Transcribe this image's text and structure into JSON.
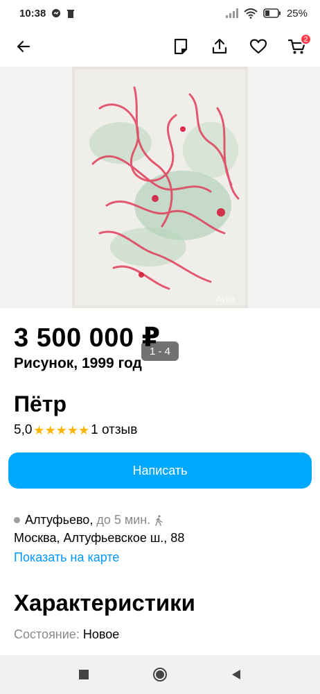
{
  "status_bar": {
    "time": "10:38",
    "battery": "25%"
  },
  "toolbar": {
    "cart_count": "2"
  },
  "gallery": {
    "counter": "1 - 4",
    "watermark": "Avito"
  },
  "listing": {
    "price": "3 500 000 ₽",
    "title": "Рисунок, 1999 год"
  },
  "seller": {
    "name": "Пётр",
    "rating": "5,0",
    "stars": 5,
    "reviews": "1 отзыв"
  },
  "actions": {
    "write_label": "Написать"
  },
  "location": {
    "metro": "Алтуфьево,",
    "time": "до 5 мин.",
    "address": "Москва, Алтуфьевское ш., 88",
    "map_link": "Показать на карте"
  },
  "characteristics": {
    "title": "Характеристики",
    "items": [
      {
        "label": "Состояние:",
        "value": "Новое"
      }
    ]
  },
  "colors": {
    "accent": "#00a8ff",
    "link": "#0095ff",
    "star": "#ffb400",
    "badge": "#ff3b4a"
  }
}
